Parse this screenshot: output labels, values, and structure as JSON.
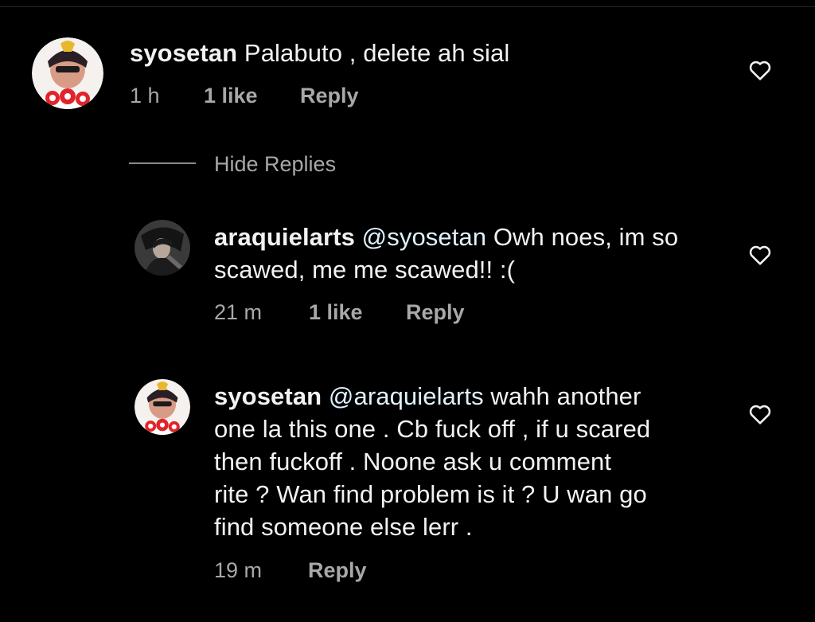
{
  "comments": [
    {
      "username": "syosetan",
      "text": " Palabuto , delete ah sial",
      "time": "1 h",
      "likes": "1 like",
      "reply": "Reply",
      "avatar_icon": "profile-avatar-icon"
    },
    {
      "username": "araquielarts",
      "mention": "@syosetan",
      "text_line1": " Owh noes, im so",
      "text_line2": "scawed, me me scawed!! :(",
      "time": "21 m",
      "likes": "1 like",
      "reply": "Reply",
      "avatar_icon": "profile-avatar-icon"
    },
    {
      "username": "syosetan",
      "mention": "@araquielarts",
      "text_line1": " wahh another",
      "text_line2": "one la this one . Cb fuck off , if u scared",
      "text_line3": "then fuckoff . Noone ask u comment",
      "text_line4": "rite ? Wan find problem is it ? U wan go",
      "text_line5": "find someone else lerr .",
      "time": "19 m",
      "reply": "Reply",
      "avatar_icon": "profile-avatar-icon"
    }
  ],
  "thread": {
    "hide_replies": "Hide Replies"
  },
  "icons": {
    "like": "heart-outline-icon"
  },
  "colors": {
    "background": "#000000",
    "primary_text": "#f2f2f2",
    "secondary_text": "#a8a8a8",
    "mention": "#e0f1ff"
  }
}
